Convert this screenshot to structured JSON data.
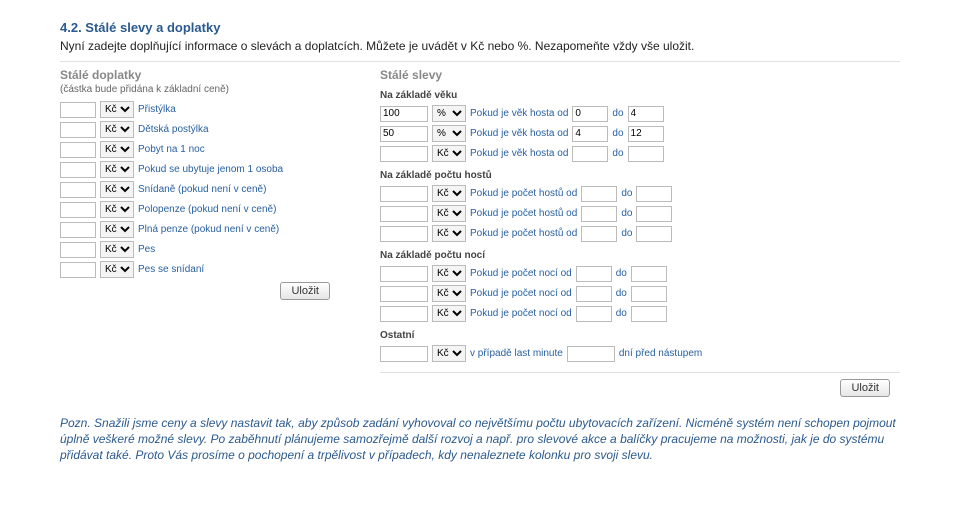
{
  "heading": "4.2. Stálé slevy a doplatky",
  "intro": "Nyní zadejte doplňující informace o slevách a doplatcích. Můžete je uvádět v Kč nebo %. Nezapomeňte vždy vše uložit.",
  "currency_option": "Kč",
  "buttons": {
    "save": "Uložit"
  },
  "surcharges": {
    "title": "Stálé doplatky",
    "subtitle": "(částka bude přidána k základní ceně)",
    "items": [
      "Přistýlka",
      "Dětská postýlka",
      "Pobyt na 1 noc",
      "Pokud se ubytuje jenom 1 osoba",
      "Snídaně (pokud není v ceně)",
      "Polopenze (pokud není v ceně)",
      "Plná penze (pokud není v ceně)",
      "Pes",
      "Pes se snídaní"
    ]
  },
  "discounts": {
    "title": "Stálé slevy",
    "age": {
      "title": "Na základě věku",
      "rows": [
        {
          "amount": "100",
          "unit": "%",
          "text": "Pokud je věk hosta od",
          "from": "0",
          "to": "4"
        },
        {
          "amount": "50",
          "unit": "%",
          "text": "Pokud je věk hosta od",
          "from": "4",
          "to": "12"
        },
        {
          "amount": "",
          "unit": "Kč",
          "text": "Pokud je věk hosta od",
          "from": "",
          "to": ""
        }
      ],
      "word_to": "do"
    },
    "guests": {
      "title": "Na základě počtu hostů",
      "row_text": "Pokud je počet hostů od",
      "word_to": "do",
      "rows": 3
    },
    "nights": {
      "title": "Na základě počtu nocí",
      "row_text": "Pokud je počet nocí od",
      "word_to": "do",
      "rows": 3
    },
    "other": {
      "title": "Ostatní",
      "text1": "v případě last minute",
      "text2": "dní před nástupem"
    }
  },
  "note": "Pozn. Snažili jsme ceny a slevy nastavit tak, aby způsob zadání vyhovoval co největšímu počtu ubytovacích zařízení. Nicméně systém není schopen pojmout úplně veškeré možné slevy. Po zaběhnutí plánujeme samozřejmě další rozvoj a např. pro slevové akce a balíčky pracujeme na možnosti, jak je do systému přidávat také. Proto Vás prosíme o pochopení a trpělivost v případech, kdy nenaleznete kolonku pro svoji slevu."
}
